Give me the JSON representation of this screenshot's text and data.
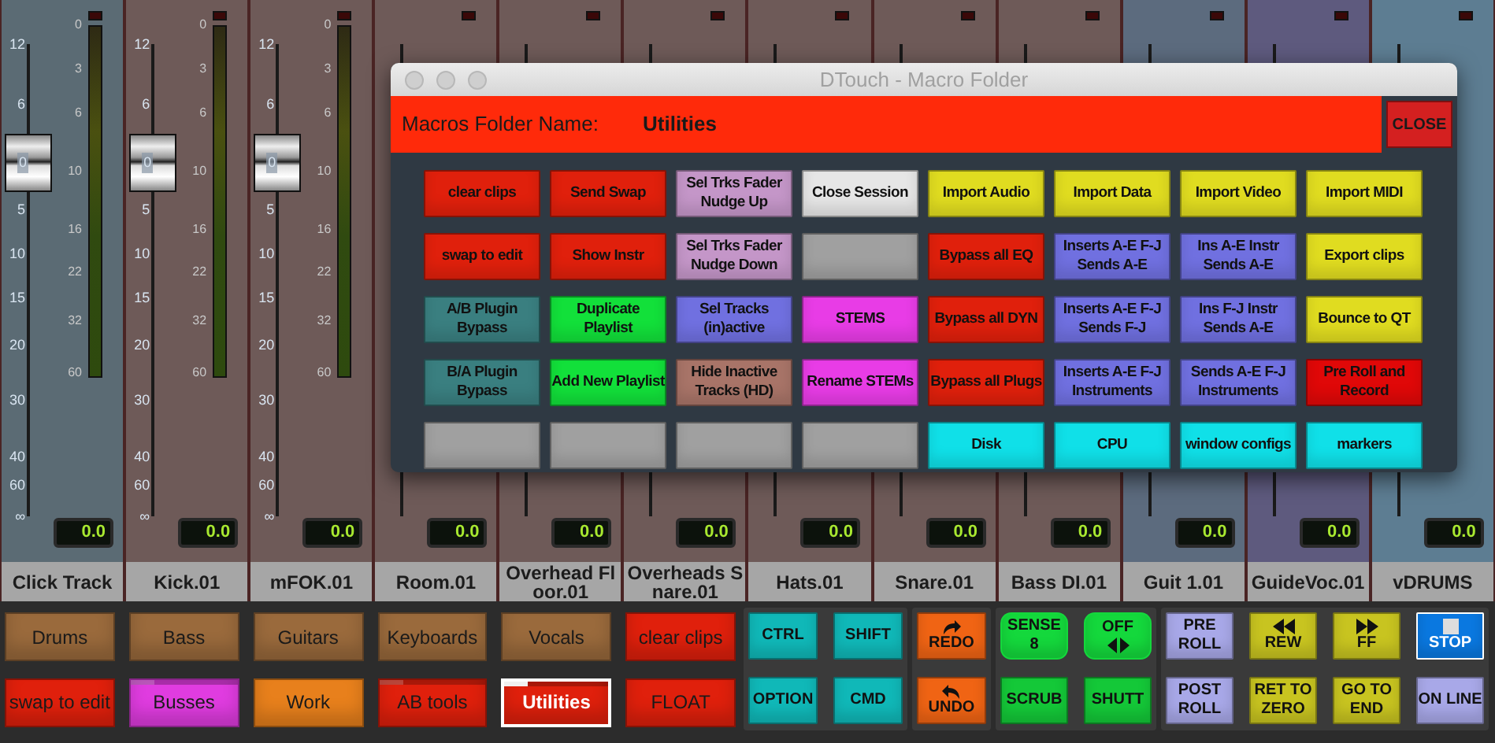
{
  "strips": [
    {
      "name": "Click Track",
      "color": "#5b6b74",
      "readout": "0.0",
      "fader_scale": [
        "12",
        "6",
        "5",
        "10",
        "15",
        "20",
        "30",
        "40",
        "60",
        "∞"
      ],
      "fader_cap_label": "0",
      "meter_scale": [
        "0",
        "3",
        "6",
        "10",
        "16",
        "22",
        "32",
        "60"
      ]
    },
    {
      "name": "Kick.01",
      "color": "#6e5a58",
      "readout": "0.0",
      "fader_scale": [
        "12",
        "6",
        "5",
        "10",
        "15",
        "20",
        "30",
        "40",
        "60",
        "∞"
      ],
      "fader_cap_label": "0",
      "meter_scale": [
        "0",
        "3",
        "6",
        "10",
        "16",
        "22",
        "32",
        "60"
      ]
    },
    {
      "name": "mFOK.01",
      "color": "#6e5a58",
      "readout": "0.0",
      "fader_scale": [
        "12",
        "6",
        "5",
        "10",
        "15",
        "20",
        "30",
        "40",
        "60",
        "∞"
      ],
      "fader_cap_label": "0",
      "meter_scale": [
        "0",
        "3",
        "6",
        "10",
        "16",
        "22",
        "32",
        "60"
      ]
    },
    {
      "name": "Room.01",
      "color": "#6e5a58",
      "readout": "0.0"
    },
    {
      "name": "Overhead Floor.01",
      "color": "#6e5a58",
      "readout": "0.0"
    },
    {
      "name": "Overheads Snare.01",
      "color": "#6e5a58",
      "readout": "0.0"
    },
    {
      "name": "Hats.01",
      "color": "#6e5a58",
      "readout": "0.0"
    },
    {
      "name": "Snare.01",
      "color": "#6e5a58",
      "readout": "0.0"
    },
    {
      "name": "Bass DI.01",
      "color": "#6e5a58",
      "readout": "0.0"
    },
    {
      "name": "Guit 1.01",
      "color": "#5c6b7e",
      "readout": "0.0"
    },
    {
      "name": "GuideVoc.01",
      "color": "#5e5a7e",
      "readout": "0.0"
    },
    {
      "name": "vDRUMS",
      "color": "#5d7d92",
      "readout": "0.0"
    }
  ],
  "dialog": {
    "title": "DTouch - Macro Folder",
    "folder_label": "Macros Folder Name:",
    "folder_name": "Utilities",
    "close": "CLOSE",
    "buttons": [
      {
        "label": "clear clips",
        "color": "#e0200c"
      },
      {
        "label": "Send Swap",
        "color": "#e0200c"
      },
      {
        "label": "Sel Trks Fader Nudge Up",
        "color": "#c496c8"
      },
      {
        "label": "Close Session",
        "color": "#e6e6e6"
      },
      {
        "label": "Import Audio",
        "color": "#e0dc20"
      },
      {
        "label": "Import Data",
        "color": "#e0dc20"
      },
      {
        "label": "Import Video",
        "color": "#e0dc20"
      },
      {
        "label": "Import MIDI",
        "color": "#e0dc20"
      },
      {
        "label": "swap to edit",
        "color": "#e0200c"
      },
      {
        "label": "Show Instr",
        "color": "#e0200c"
      },
      {
        "label": "Sel Trks Fader Nudge Down",
        "color": "#c496c8"
      },
      {
        "color": "#a0a0a0"
      },
      {
        "label": "Bypass all EQ",
        "color": "#e0200c"
      },
      {
        "label": "Inserts A-E F-J Sends A-E",
        "color": "#7070e0"
      },
      {
        "label": "Ins A-E Instr Sends A-E",
        "color": "#7070e0"
      },
      {
        "label": "Export clips",
        "color": "#e0dc20"
      },
      {
        "label": "A/B Plugin Bypass",
        "color": "#3a7f80"
      },
      {
        "label": "Duplicate Playlist",
        "color": "#12e03a"
      },
      {
        "label": "Sel Tracks (in)active",
        "color": "#7070e0"
      },
      {
        "label": "STEMS",
        "color": "#e83ce6"
      },
      {
        "label": "Bypass all DYN",
        "color": "#e0200c"
      },
      {
        "label": "Inserts A-E F-J Sends F-J",
        "color": "#7070e0"
      },
      {
        "label": "Ins F-J Instr Sends A-E",
        "color": "#7070e0"
      },
      {
        "label": "Bounce to QT",
        "color": "#e0dc20"
      },
      {
        "label": "B/A Plugin Bypass",
        "color": "#3a7f80"
      },
      {
        "label": "Add New Playlist",
        "color": "#12e03a"
      },
      {
        "label": "Hide Inactive Tracks (HD)",
        "color": "#a87468"
      },
      {
        "label": "Rename STEMs",
        "color": "#e83ce6"
      },
      {
        "label": "Bypass all Plugs",
        "color": "#e0200c"
      },
      {
        "label": "Inserts A-E F-J Instruments",
        "color": "#7070e0"
      },
      {
        "label": "Sends A-E F-J Instruments",
        "color": "#7070e0"
      },
      {
        "label": "Pre Roll and Record",
        "color": "#e00808"
      },
      {
        "color": "#a0a0a0"
      },
      {
        "color": "#a0a0a0"
      },
      {
        "color": "#a0a0a0"
      },
      {
        "color": "#a0a0a0"
      },
      {
        "label": "Disk",
        "color": "#10e0e8"
      },
      {
        "label": "CPU",
        "color": "#10e0e8"
      },
      {
        "label": "window configs",
        "color": "#10e0e8"
      },
      {
        "label": "markers",
        "color": "#10e0e8"
      }
    ]
  },
  "folders": [
    {
      "label": "Drums",
      "color": "#9a6a3c",
      "kind": "macro",
      "selected": false
    },
    {
      "label": "Bass",
      "color": "#9a6a3c",
      "kind": "macro",
      "selected": false
    },
    {
      "label": "Guitars",
      "color": "#9a6a3c",
      "kind": "macro",
      "selected": false
    },
    {
      "label": "Keyboards",
      "color": "#9a6a3c",
      "kind": "macro",
      "selected": false
    },
    {
      "label": "Vocals",
      "color": "#9a6a3c",
      "kind": "macro",
      "selected": false
    },
    {
      "label": "clear clips",
      "color": "#e0200c",
      "kind": "macro",
      "selected": false
    },
    {
      "label": "swap to edit",
      "color": "#e0200c",
      "kind": "macro",
      "selected": false
    },
    {
      "label": "Busses",
      "color": "#e03ce0",
      "kind": "folder",
      "selected": false
    },
    {
      "label": "Work",
      "color": "#e8801c",
      "kind": "macro",
      "selected": false
    },
    {
      "label": "AB tools",
      "color": "#e0200c",
      "kind": "folder",
      "selected": false
    },
    {
      "label": "Utilities",
      "color": "#e0200c",
      "kind": "folder",
      "selected": true
    },
    {
      "label": "FLOAT",
      "color": "#e0200c",
      "kind": "macro",
      "selected": false
    }
  ],
  "control_groups": [
    {
      "buttons": [
        {
          "label": "CTRL",
          "color": "#10b8b8"
        },
        {
          "label": "SHIFT",
          "color": "#10b8b8"
        },
        {
          "label": "OPTION",
          "color": "#10b8b8"
        },
        {
          "label": "CMD",
          "color": "#10b8b8"
        }
      ]
    },
    {
      "buttons": [
        {
          "label": "REDO",
          "color": "#f06414"
        },
        {
          "label": "UNDO",
          "color": "#f06414"
        }
      ]
    },
    {
      "buttons": [
        {
          "label": "SENSE\n8",
          "color": "#14d83c"
        },
        {
          "label": "OFF",
          "color": "#14d83c"
        },
        {
          "label": "SCRUB",
          "color": "#14c838"
        },
        {
          "label": "SHUTT",
          "color": "#14c838"
        }
      ]
    },
    {
      "buttons": [
        {
          "label": "PRE\nROLL",
          "color": "#a8a8e8"
        },
        {
          "label": "REW",
          "color": "#c8c420"
        },
        {
          "label": "FF",
          "color": "#c8c420"
        },
        {
          "label": "STOP",
          "color": "#0a78e0"
        },
        {
          "label": "POST\nROLL",
          "color": "#a8a8e8"
        },
        {
          "label": "RET TO\nZERO",
          "color": "#c8c420"
        },
        {
          "label": "GO TO\nEND",
          "color": "#c8c420"
        },
        {
          "label": "ON LINE",
          "color": "#a8a8e8"
        }
      ]
    }
  ]
}
